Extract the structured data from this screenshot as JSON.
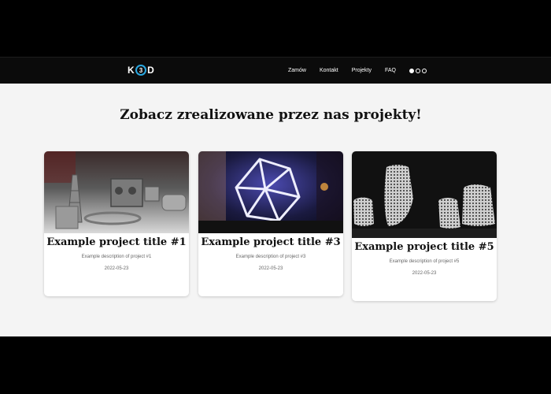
{
  "header": {
    "logo_text": "K3D",
    "nav": [
      {
        "label": "Zamów"
      },
      {
        "label": "Kontakt"
      },
      {
        "label": "Projekty"
      },
      {
        "label": "FAQ"
      }
    ],
    "social_icons": [
      "facebook-icon",
      "messenger-icon",
      "instagram-icon"
    ]
  },
  "main": {
    "heading": "Zobacz zrealizowane przez nas projekty!",
    "projects": [
      {
        "title": "Example project title #1",
        "description": "Example description of project #1",
        "date": "2022-05-23"
      },
      {
        "title": "Example project title #3",
        "description": "Example description of project #3",
        "date": "2022-05-23"
      },
      {
        "title": "Example project title #5",
        "description": "Example description of project #5",
        "date": "2022-05-23"
      }
    ]
  },
  "colors": {
    "page_background": "#f4f4f4",
    "navbar_background": "#0b0b0b",
    "logo_accent": "#2aa7e0"
  }
}
